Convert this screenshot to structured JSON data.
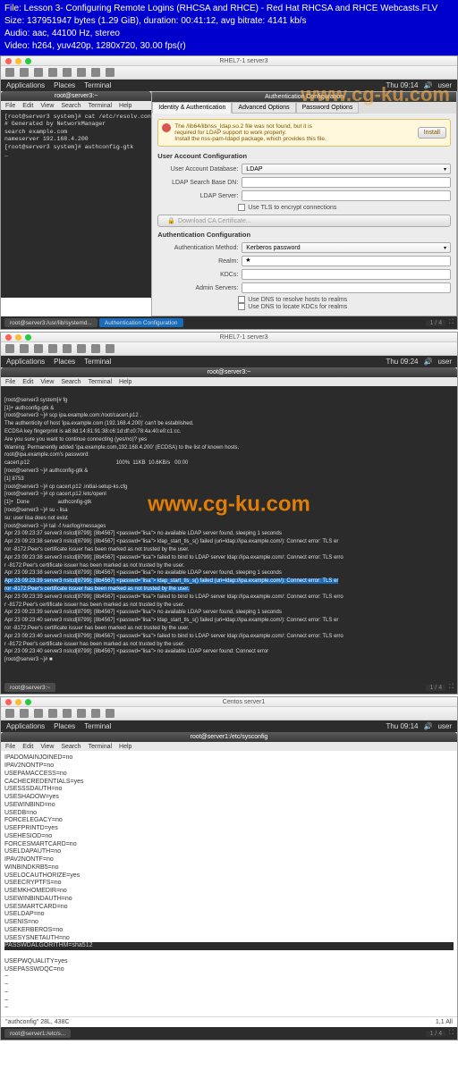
{
  "header": {
    "file": "File: Lesson 3- Configuring Remote Logins (RHCSA and RHCE) - Red Hat RHCSA and RHCE Webcasts.FLV",
    "size": "Size: 137951947 bytes (1.29 GiB), duration: 00:41:12, avg bitrate: 4141 kb/s",
    "audio": "Audio: aac, 44100 Hz, stereo",
    "video": "Video: h264, yuv420p, 1280x720, 30.00 fps(r)"
  },
  "watermark": "www.cg-ku.com",
  "gnome": {
    "apps": "Applications",
    "places": "Places",
    "term": "Terminal",
    "time1": "Thu 09:14",
    "time2": "Thu 09:24",
    "user": "user"
  },
  "mac": {
    "title1": "RHEL7-1 server3",
    "title2": "RHEL7-1 server3",
    "title3": "Centos server1"
  },
  "termmenu": {
    "file": "File",
    "edit": "Edit",
    "view": "View",
    "search": "Search",
    "terminal": "Terminal",
    "help": "Help"
  },
  "shot1": {
    "termtitle": "root@server3:~",
    "termtext": "[root@server3 system]# cat /etc/resolv.conf\n# Generated by NetworkManager\nsearch example.com\nnameserver 192.168.4.200\n[root@server3 system]# authconfig-gtk\n_"
  },
  "dlg": {
    "title": "Authentication Configuration",
    "tab1": "Identity & Authentication",
    "tab2": "Advanced Options",
    "tab3": "Password Options",
    "warn1": "The /lib64/libnss_ldap.so.2 file was not found, but it is",
    "warn2": "required for LDAP support to work properly.",
    "warn3": "Install the nss-pam-ldapd package, which provides this file.",
    "install": "Install",
    "sec1": "User Account Configuration",
    "lbl_db": "User Account Database:",
    "val_db": "LDAP",
    "lbl_base": "LDAP Search Base DN:",
    "lbl_srv": "LDAP Server:",
    "chk_tls": "Use TLS to encrypt connections",
    "dlcert": "Download CA Certificate...",
    "sec2": "Authentication Configuration",
    "lbl_auth": "Authentication Method:",
    "val_auth": "Kerberos password",
    "lbl_realm": "Realm:",
    "lbl_kdc": "KDCs:",
    "lbl_admin": "Admin Servers:",
    "chk_dns1": "Use DNS to resolve hosts to realms",
    "chk_dns2": "Use DNS to locate KDCs for realms"
  },
  "task1": {
    "item1": "root@server3:/usr/lib/systemd...",
    "item2": "Authentication Configuration",
    "page": "1 / 4"
  },
  "shot2": {
    "termtitle": "root@server3:~",
    "text": "[root@server3 system]# fg\n[1]+ authconfig-gtk &\n[root@server3 ~]# scp ipa.example.com:/root/cacert.p12 .\nThe authenticity of host 'ipa.example.com (192.168.4.200)' can't be established.\nECDSA key fingerprint is a8:8d:14:81:91:38:c6:1d:df:c0:78:4a:40:e0:c1:cc.\nAre you sure you want to continue connecting (yes/no)? yes\nWarning: Permanently added 'ipa.example.com,192.168.4.200' (ECDSA) to the list of known hosts.\nroot@ipa.example.com's password:\ncacert.p12                                                          100%  11KB  10.6KB/s   00:00\n[root@server3 ~]# authconfig-gtk &\n[1] 8753\n[root@server3 ~]# cp cacert.p12 .initial-setup-ks.cfg\n[root@server3 ~]# cp cacert.p12 /etc/openl\n[1]+  Done                   authconfig-gtk\n[root@server3 ~]# su - lisa\nsu: user lisa does not exist\n[root@server3 ~]# tail -f /var/log/messages\nApr 23 09:23:37 server3 nslcd[8799]: [8b4567] <passwd=\"lisa\"> no available LDAP server found, sleeping 1 seconds\nApr 23 09:23:38 server3 nslcd[8799]: [8b4567] <passwd=\"lisa\"> ldap_start_tls_s() failed (uri=ldap://ipa.example.com/): Connect error: TLS er\nror -8172:Peer's certificate issuer has been marked as not trusted by the user.\nApr 23 09:23:38 server3 nslcd[8799]: [8b4567] <passwd=\"lisa\"> failed to bind to LDAP server ldap://ipa.example.com/: Connect error: TLS erro\nr -8172:Peer's certificate issuer has been marked as not trusted by the user.\nApr 23 09:23:38 server3 nslcd[8799]: [8b4567] <passwd=\"lisa\"> no available LDAP server found, sleeping 1 seconds",
    "hl": "Apr 23 09:23:39 server3 nslcd[8799]: [8b4567] <passwd=\"lisa\"> ldap_start_tls_s() failed (uri=ldap://ipa.example.com/): Connect error: TLS er\nror -8172:Peer's certificate issuer has been marked as not trusted by the user.",
    "text2": "Apr 23 09:23:39 server3 nslcd[8799]: [8b4567] <passwd=\"lisa\"> failed to bind to LDAP server ldap://ipa.example.com/: Connect error: TLS erro\nr -8172:Peer's certificate issuer has been marked as not trusted by the user.\nApr 23 09:23:39 server3 nslcd[8799]: [8b4567] <passwd=\"lisa\"> no available LDAP server found, sleeping 1 seconds\nApr 23 09:23:40 server3 nslcd[8799]: [8b4567] <passwd=\"lisa\"> ldap_start_tls_s() failed (uri=ldap://ipa.example.com/): Connect error: TLS er\nror -8172:Peer's certificate issuer has been marked as not trusted by the user.\nApr 23 09:23:40 server3 nslcd[8799]: [8b4567] <passwd=\"lisa\"> failed to bind to LDAP server ldap://ipa.example.com/: Connect error: TLS erro\nr -8172:Peer's certificate issuer has been marked as not trusted by the user.\nApr 23 09:23:40 server3 nslcd[8799]: [8b4567] <passwd=\"lisa\"> no available LDAP server found: Connect error\n[root@server3 ~]# ■",
    "page": "1 / 4"
  },
  "task2": {
    "item1": "root@server3:~"
  },
  "shot3": {
    "termtitle": "root@server1:/etc/sysconfig",
    "text": "IPADOMAINJOINED=no\nIPAV2NONTP=no\nUSEPAMACCESS=no\nCACHECREDENTIALS=yes\nUSESSSDAUTH=no\nUSESHADOW=yes\nUSEWINBIND=no\nUSEDB=no\nFORCELEGACY=no\nUSEFPRINTD=yes\nUSEHESIOD=no\nFORCESMARTCARD=no\nUSELDAPAUTH=no\nIPAV2NONTF=no\nWINBINDKRB5=no\nUSELOCAUTHORIZE=yes\nUSEECRYPTFS=no\nUSEMKHOMEDIR=no\nUSEWINBINDAUTH=no\nUSESMARTCARD=no\nUSELDAP=no\nUSENIS=no\nUSEKERBEROS=no\nUSESYSNETAUTH=no",
    "hl": "PASSWDALGORITHM=sha512",
    "text2": "USEPWQUALITY=yes\nUSEPASSWDQC=no\n~\n~\n~\n~\n~",
    "status_l": "\"authconfig\" 28L, 438C",
    "status_r": "1,1        All",
    "page": "1 / 4"
  },
  "task3": {
    "item1": "root@server1:/etc/s..."
  }
}
